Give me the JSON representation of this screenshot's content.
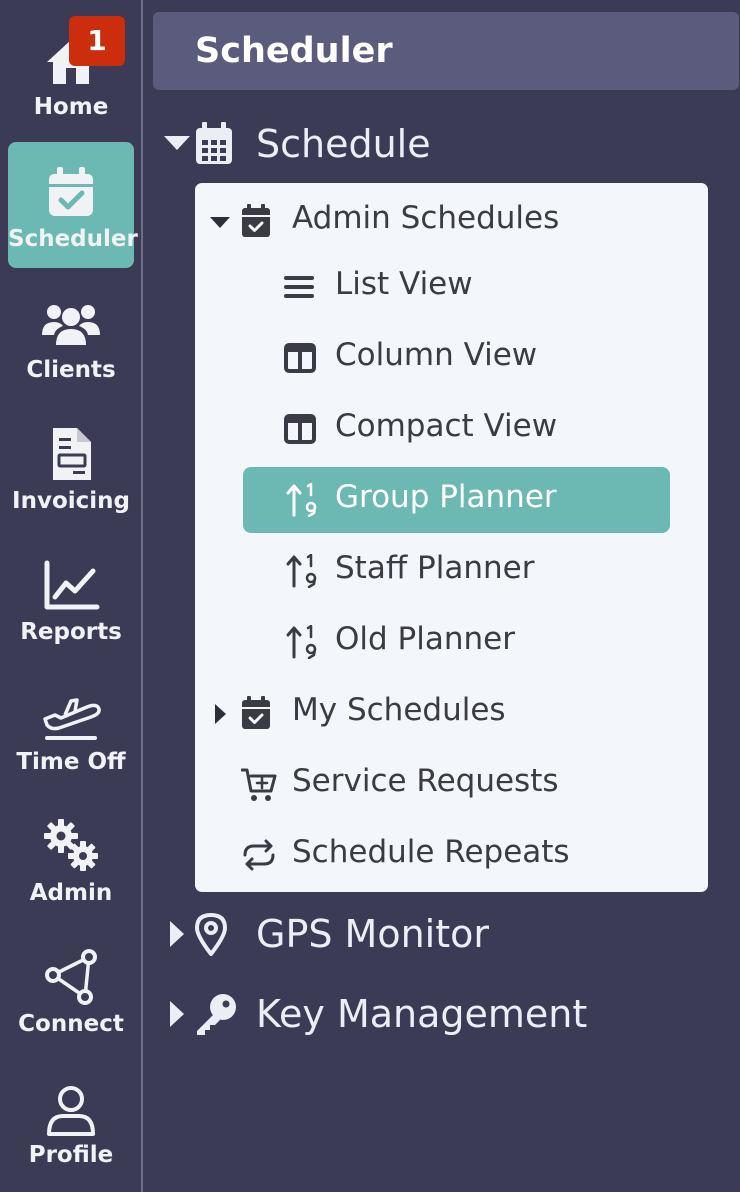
{
  "rail": {
    "items": [
      {
        "label": "Home",
        "icon": "home-icon",
        "badge": "1"
      },
      {
        "label": "Scheduler",
        "icon": "calendar-check-icon"
      },
      {
        "label": "Clients",
        "icon": "users-icon"
      },
      {
        "label": "Invoicing",
        "icon": "invoice-icon"
      },
      {
        "label": "Reports",
        "icon": "chart-line-icon"
      },
      {
        "label": "Time Off",
        "icon": "plane-departure-icon"
      },
      {
        "label": "Admin",
        "icon": "gears-icon"
      },
      {
        "label": "Connect",
        "icon": "share-nodes-icon"
      },
      {
        "label": "Profile",
        "icon": "user-icon"
      }
    ],
    "active": "Scheduler"
  },
  "panel": {
    "title": "Scheduler",
    "sections": {
      "schedule": {
        "label": "Schedule",
        "icon": "calendar-icon",
        "expanded": true
      },
      "gps": {
        "label": "GPS Monitor",
        "icon": "location-pin-icon",
        "expanded": false
      },
      "keys": {
        "label": "Key Management",
        "icon": "key-icon",
        "expanded": false
      }
    },
    "schedule_items": [
      {
        "label": "Admin Schedules",
        "icon": "calendar-check-icon",
        "expanded": true
      },
      {
        "label": "List View",
        "icon": "list-icon"
      },
      {
        "label": "Column View",
        "icon": "columns-icon"
      },
      {
        "label": "Compact View",
        "icon": "columns-icon"
      },
      {
        "label": "Group Planner",
        "icon": "sort-number-icon",
        "active": true
      },
      {
        "label": "Staff Planner",
        "icon": "sort-number-icon"
      },
      {
        "label": "Old Planner",
        "icon": "sort-number-icon"
      },
      {
        "label": "My Schedules",
        "icon": "calendar-check-icon",
        "expanded": false
      },
      {
        "label": "Service Requests",
        "icon": "cart-plus-icon"
      },
      {
        "label": "Schedule Repeats",
        "icon": "repeat-icon"
      }
    ]
  },
  "colors": {
    "background": "#3b3b55",
    "accent": "#6cb8b3",
    "badge": "#cb2d0d",
    "title_bar": "#5b5b7d",
    "menu_card": "#f3f6fa"
  }
}
